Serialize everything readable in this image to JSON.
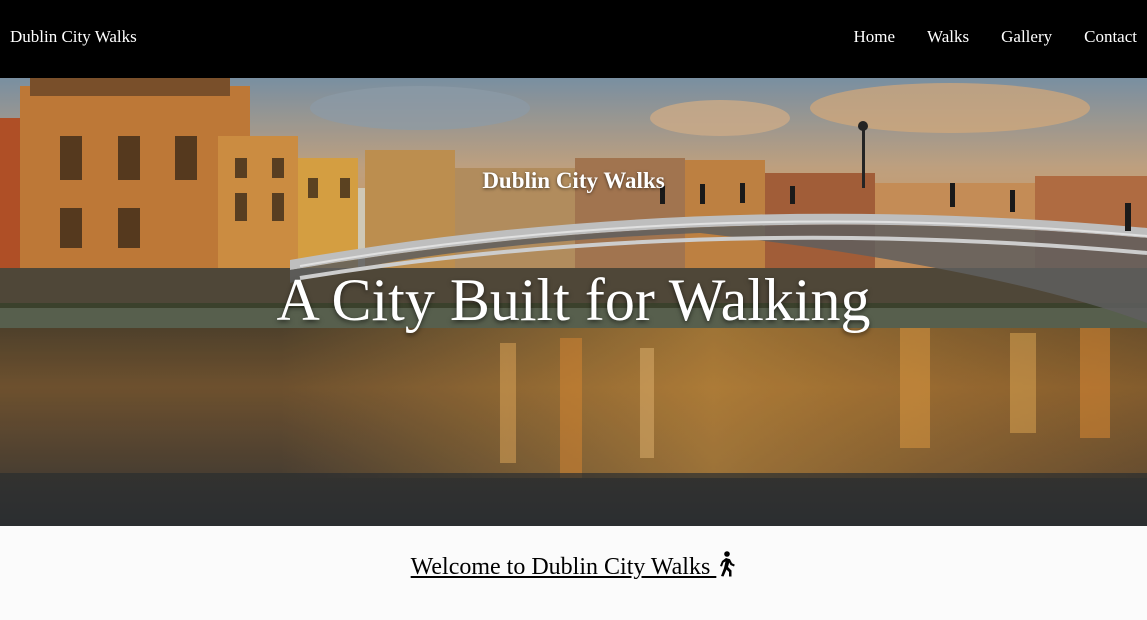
{
  "nav": {
    "brand": "Dublin City Walks",
    "links": [
      "Home",
      "Walks",
      "Gallery",
      "Contact"
    ]
  },
  "hero": {
    "subtitle": "Dublin City Walks",
    "title": "A City Built for Walking",
    "image_description_icon": "ha-penny-bridge-photo"
  },
  "welcome": {
    "heading": "Welcome to Dublin City Walks ",
    "icon": "person-walking-icon"
  },
  "colors": {
    "nav_bg": "#000000",
    "nav_text": "#ffffff",
    "page_bg": "#fbfbfb"
  }
}
